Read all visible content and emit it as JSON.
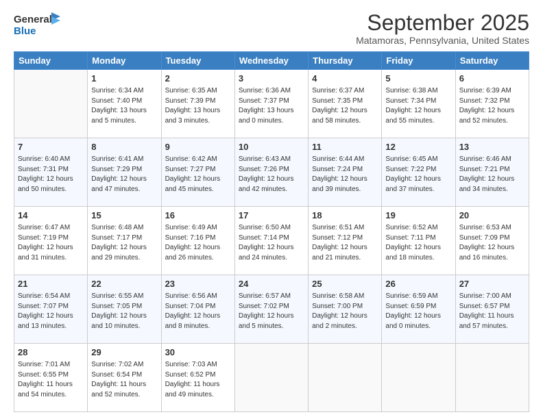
{
  "logo": {
    "line1": "General",
    "line2": "Blue"
  },
  "header": {
    "month": "September 2025",
    "location": "Matamoras, Pennsylvania, United States"
  },
  "days_of_week": [
    "Sunday",
    "Monday",
    "Tuesday",
    "Wednesday",
    "Thursday",
    "Friday",
    "Saturday"
  ],
  "weeks": [
    [
      {
        "day": "",
        "sunrise": "",
        "sunset": "",
        "daylight": ""
      },
      {
        "day": "1",
        "sunrise": "Sunrise: 6:34 AM",
        "sunset": "Sunset: 7:40 PM",
        "daylight": "Daylight: 13 hours and 5 minutes."
      },
      {
        "day": "2",
        "sunrise": "Sunrise: 6:35 AM",
        "sunset": "Sunset: 7:39 PM",
        "daylight": "Daylight: 13 hours and 3 minutes."
      },
      {
        "day": "3",
        "sunrise": "Sunrise: 6:36 AM",
        "sunset": "Sunset: 7:37 PM",
        "daylight": "Daylight: 13 hours and 0 minutes."
      },
      {
        "day": "4",
        "sunrise": "Sunrise: 6:37 AM",
        "sunset": "Sunset: 7:35 PM",
        "daylight": "Daylight: 12 hours and 58 minutes."
      },
      {
        "day": "5",
        "sunrise": "Sunrise: 6:38 AM",
        "sunset": "Sunset: 7:34 PM",
        "daylight": "Daylight: 12 hours and 55 minutes."
      },
      {
        "day": "6",
        "sunrise": "Sunrise: 6:39 AM",
        "sunset": "Sunset: 7:32 PM",
        "daylight": "Daylight: 12 hours and 52 minutes."
      }
    ],
    [
      {
        "day": "7",
        "sunrise": "Sunrise: 6:40 AM",
        "sunset": "Sunset: 7:31 PM",
        "daylight": "Daylight: 12 hours and 50 minutes."
      },
      {
        "day": "8",
        "sunrise": "Sunrise: 6:41 AM",
        "sunset": "Sunset: 7:29 PM",
        "daylight": "Daylight: 12 hours and 47 minutes."
      },
      {
        "day": "9",
        "sunrise": "Sunrise: 6:42 AM",
        "sunset": "Sunset: 7:27 PM",
        "daylight": "Daylight: 12 hours and 45 minutes."
      },
      {
        "day": "10",
        "sunrise": "Sunrise: 6:43 AM",
        "sunset": "Sunset: 7:26 PM",
        "daylight": "Daylight: 12 hours and 42 minutes."
      },
      {
        "day": "11",
        "sunrise": "Sunrise: 6:44 AM",
        "sunset": "Sunset: 7:24 PM",
        "daylight": "Daylight: 12 hours and 39 minutes."
      },
      {
        "day": "12",
        "sunrise": "Sunrise: 6:45 AM",
        "sunset": "Sunset: 7:22 PM",
        "daylight": "Daylight: 12 hours and 37 minutes."
      },
      {
        "day": "13",
        "sunrise": "Sunrise: 6:46 AM",
        "sunset": "Sunset: 7:21 PM",
        "daylight": "Daylight: 12 hours and 34 minutes."
      }
    ],
    [
      {
        "day": "14",
        "sunrise": "Sunrise: 6:47 AM",
        "sunset": "Sunset: 7:19 PM",
        "daylight": "Daylight: 12 hours and 31 minutes."
      },
      {
        "day": "15",
        "sunrise": "Sunrise: 6:48 AM",
        "sunset": "Sunset: 7:17 PM",
        "daylight": "Daylight: 12 hours and 29 minutes."
      },
      {
        "day": "16",
        "sunrise": "Sunrise: 6:49 AM",
        "sunset": "Sunset: 7:16 PM",
        "daylight": "Daylight: 12 hours and 26 minutes."
      },
      {
        "day": "17",
        "sunrise": "Sunrise: 6:50 AM",
        "sunset": "Sunset: 7:14 PM",
        "daylight": "Daylight: 12 hours and 24 minutes."
      },
      {
        "day": "18",
        "sunrise": "Sunrise: 6:51 AM",
        "sunset": "Sunset: 7:12 PM",
        "daylight": "Daylight: 12 hours and 21 minutes."
      },
      {
        "day": "19",
        "sunrise": "Sunrise: 6:52 AM",
        "sunset": "Sunset: 7:11 PM",
        "daylight": "Daylight: 12 hours and 18 minutes."
      },
      {
        "day": "20",
        "sunrise": "Sunrise: 6:53 AM",
        "sunset": "Sunset: 7:09 PM",
        "daylight": "Daylight: 12 hours and 16 minutes."
      }
    ],
    [
      {
        "day": "21",
        "sunrise": "Sunrise: 6:54 AM",
        "sunset": "Sunset: 7:07 PM",
        "daylight": "Daylight: 12 hours and 13 minutes."
      },
      {
        "day": "22",
        "sunrise": "Sunrise: 6:55 AM",
        "sunset": "Sunset: 7:05 PM",
        "daylight": "Daylight: 12 hours and 10 minutes."
      },
      {
        "day": "23",
        "sunrise": "Sunrise: 6:56 AM",
        "sunset": "Sunset: 7:04 PM",
        "daylight": "Daylight: 12 hours and 8 minutes."
      },
      {
        "day": "24",
        "sunrise": "Sunrise: 6:57 AM",
        "sunset": "Sunset: 7:02 PM",
        "daylight": "Daylight: 12 hours and 5 minutes."
      },
      {
        "day": "25",
        "sunrise": "Sunrise: 6:58 AM",
        "sunset": "Sunset: 7:00 PM",
        "daylight": "Daylight: 12 hours and 2 minutes."
      },
      {
        "day": "26",
        "sunrise": "Sunrise: 6:59 AM",
        "sunset": "Sunset: 6:59 PM",
        "daylight": "Daylight: 12 hours and 0 minutes."
      },
      {
        "day": "27",
        "sunrise": "Sunrise: 7:00 AM",
        "sunset": "Sunset: 6:57 PM",
        "daylight": "Daylight: 11 hours and 57 minutes."
      }
    ],
    [
      {
        "day": "28",
        "sunrise": "Sunrise: 7:01 AM",
        "sunset": "Sunset: 6:55 PM",
        "daylight": "Daylight: 11 hours and 54 minutes."
      },
      {
        "day": "29",
        "sunrise": "Sunrise: 7:02 AM",
        "sunset": "Sunset: 6:54 PM",
        "daylight": "Daylight: 11 hours and 52 minutes."
      },
      {
        "day": "30",
        "sunrise": "Sunrise: 7:03 AM",
        "sunset": "Sunset: 6:52 PM",
        "daylight": "Daylight: 11 hours and 49 minutes."
      },
      {
        "day": "",
        "sunrise": "",
        "sunset": "",
        "daylight": ""
      },
      {
        "day": "",
        "sunrise": "",
        "sunset": "",
        "daylight": ""
      },
      {
        "day": "",
        "sunrise": "",
        "sunset": "",
        "daylight": ""
      },
      {
        "day": "",
        "sunrise": "",
        "sunset": "",
        "daylight": ""
      }
    ]
  ]
}
